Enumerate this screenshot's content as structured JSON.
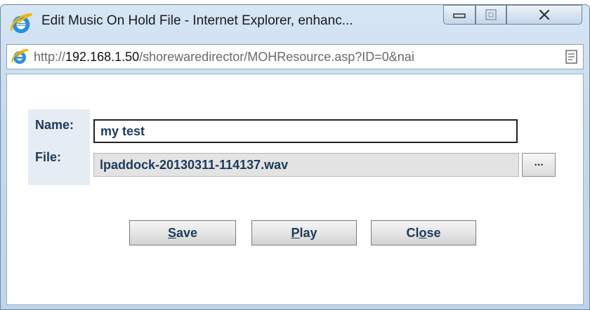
{
  "window": {
    "title": "Edit Music On Hold File - Internet Explorer, enhanc...",
    "controls": {
      "minimize_icon": "minimize-icon",
      "maximize_icon": "maximize-icon",
      "close_icon": "close-icon"
    }
  },
  "address": {
    "url_prefix": "http://",
    "url_host": "192.168.1.50",
    "url_path": "/shorewaredirector/MOHResource.asp?ID=0&nai",
    "icon": "ie-page-icon",
    "compat_icon": "compatibility-view-icon"
  },
  "form": {
    "name_label": "Name:",
    "name_value": "my test",
    "file_label": "File:",
    "file_value": "lpaddock-20130311-114137.wav",
    "browse_label": "..."
  },
  "buttons": {
    "save": {
      "underlined": "S",
      "rest": "ave"
    },
    "play": {
      "underlined": "P",
      "rest": "lay"
    },
    "close": {
      "prefix": "Cl",
      "underlined": "o",
      "rest": "se"
    }
  },
  "colors": {
    "titlebar": "#c5d9ee",
    "label_text": "#1c3a5c",
    "label_cell": "#e6ecf3"
  }
}
